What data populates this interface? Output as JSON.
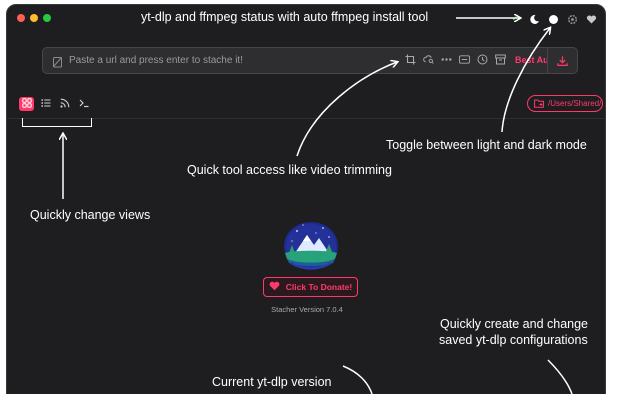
{
  "window": {
    "title_annotation": "yt-dlp and ffmpeg status with auto ffmpeg install tool"
  },
  "titlebar_icons": [
    "check-icon",
    "theme-toggle-icon",
    "circle-icon",
    "gear-icon",
    "heart-icon"
  ],
  "url_bar": {
    "placeholder": "Paste a url and press enter to stache it!",
    "quality_label": "Best Au"
  },
  "views": [
    "grid-view",
    "list-view",
    "rss-view",
    "terminal-view"
  ],
  "save_path": {
    "label": "/Users/Shared/"
  },
  "annotations": {
    "quick_tool": "Quick tool access like video trimming",
    "toggle_theme": "Toggle between light and dark mode",
    "change_views": "Quickly change views",
    "configs_line1": "Quickly create and change",
    "configs_line2": "saved yt-dlp configurations",
    "version_note": "Current yt-dlp version"
  },
  "donate": {
    "label": "Click To Donate!"
  },
  "version": "Stacher Version 7.0.4",
  "colors": {
    "accent": "#ff3a6a",
    "background": "#1e1e20",
    "success": "#3cc45c"
  }
}
